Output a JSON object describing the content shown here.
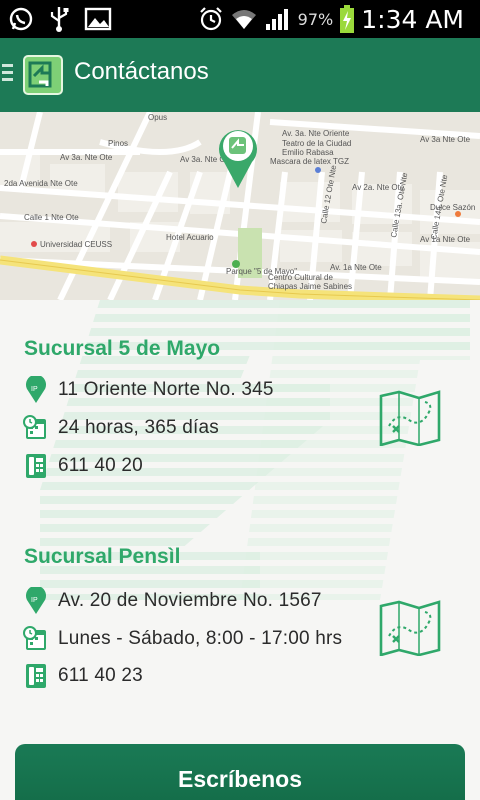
{
  "status_bar": {
    "battery_percent": "97%",
    "time": "1:34 AM",
    "icons": [
      "whatsapp-icon",
      "usb-icon",
      "image-icon",
      "alarm-icon",
      "wifi-icon",
      "signal-icon",
      "battery-charging-icon"
    ]
  },
  "action_bar": {
    "title": "Contáctanos",
    "colors": {
      "background": "#1d7a56",
      "accent": "#2fa86a"
    }
  },
  "map": {
    "labels": {
      "oriente": "Av. 3a. Nte Oriente",
      "teatro1": "Teatro de la Ciudad",
      "teatro2": "Emilio Rabasa",
      "mascara": "Mascara de latex TGZ",
      "pinos": "Pinos",
      "av3nte": "Av 3a. Nte Ote",
      "av3nte2": "Av 3a. Nte Ote",
      "av2nte": "2da Avenida Nte Ote",
      "calle1": "Calle 1 Nte Ote",
      "ceuss": "Universidad CEUSS",
      "hotel": "Hotel Acuario",
      "parque": "Parque \"5 de Mayo\"",
      "centro1": "Centro Cultural de",
      "centro2": "Chiapas Jaime Sabines",
      "dulce": "Dulce Sazón",
      "av2nte_r": "Av 2a. Nte Ote",
      "av1nte_r": "Av 1a Nte Ote",
      "av1nte_m": "Av. 1a Nte Ote",
      "av3nte_r": "Av 3a Nte Ote",
      "calle12": "Calle 12 Ote Nte",
      "calle13": "Calle 13a. Ote Nte",
      "calle14": "Calle 14a. Ote Nte",
      "opus": "Opus"
    }
  },
  "branches": [
    {
      "name": "Sucursal 5 de Mayo",
      "address": "11 Oriente Norte No. 345",
      "hours": "24 horas, 365 días",
      "phone": "611 40 20"
    },
    {
      "name": "Sucursal Pensìl",
      "address": "Av. 20 de Noviembre No. 1567",
      "hours": "Lunes - Sábado, 8:00 - 17:00 hrs",
      "phone": "611 40 23"
    }
  ],
  "write_button": {
    "label": "Escríbenos"
  }
}
